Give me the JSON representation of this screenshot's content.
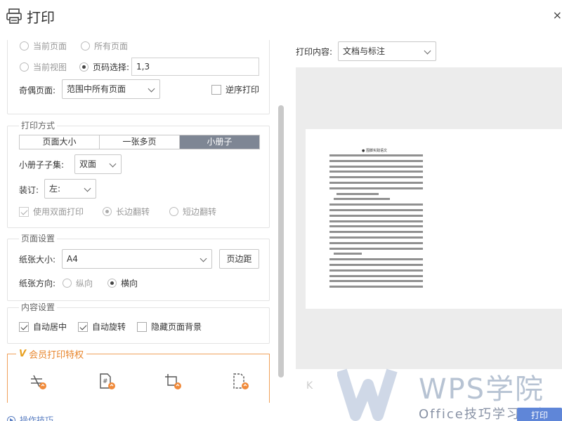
{
  "title": "打印",
  "close_glyph": "×",
  "range": {
    "current_page": "当前页面",
    "all_pages": "所有页面",
    "current_view": "当前视图",
    "page_select": "页码选择:",
    "page_value": "1,3",
    "odd_even_label": "奇偶页面:",
    "odd_even_value": "范围中所有页面",
    "reverse_label": "逆序打印"
  },
  "print_method": {
    "legend": "打印方式",
    "tabs": [
      "页面大小",
      "一张多页",
      "小册子"
    ],
    "booklet_label": "小册子子集:",
    "booklet_value": "双面",
    "binding_label": "装订:",
    "binding_value": "左:",
    "duplex_label": "使用双面打印",
    "long_edge": "长边翻转",
    "short_edge": "短边翻转"
  },
  "page_setup": {
    "legend": "页面设置",
    "paper_size_label": "纸张大小:",
    "paper_size_value": "A4",
    "margin_button": "页边距",
    "orientation_label": "纸张方向:",
    "portrait": "纵向",
    "landscape": "横向"
  },
  "content_settings": {
    "legend": "内容设置",
    "auto_center": "自动居中",
    "auto_rotate": "自动旋转",
    "hide_background": "隐藏页面背景"
  },
  "vip": {
    "badge": "V",
    "legend": "会员打印特权"
  },
  "tips": "操作技巧",
  "preview": {
    "content_label": "打印内容:",
    "content_value": "文档与标注",
    "page_heading": "● 围脚实践语文",
    "pager_prev": "K"
  },
  "print_button": "打印",
  "watermark": {
    "brand": "WPS学院",
    "slogan": "Office技巧学习平台"
  },
  "colors": {
    "accent": "#5f86d8",
    "vip": "#e8862e",
    "segment_active": "#7e8694"
  }
}
